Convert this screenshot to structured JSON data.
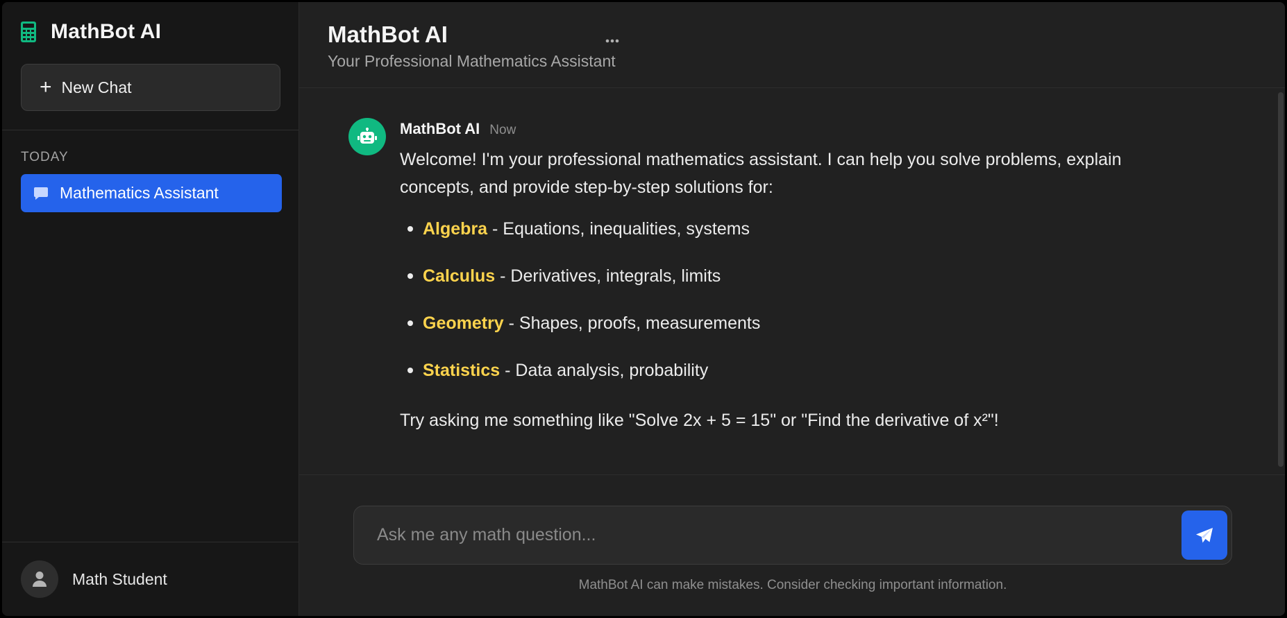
{
  "sidebar": {
    "brand_title": "MathBot AI",
    "new_chat_label": "New Chat",
    "section_label": "TODAY",
    "active_chat_label": "Mathematics Assistant",
    "user_name": "Math Student"
  },
  "header": {
    "title": "MathBot AI",
    "subtitle": "Your Professional Mathematics Assistant"
  },
  "message": {
    "author": "MathBot AI",
    "time": "Now",
    "intro": "Welcome! I'm your professional mathematics assistant. I can help you solve problems, explain concepts, and provide step-by-step solutions for:",
    "topics": [
      {
        "name": "Algebra",
        "desc": " - Equations, inequalities, systems"
      },
      {
        "name": "Calculus",
        "desc": " - Derivatives, integrals, limits"
      },
      {
        "name": "Geometry",
        "desc": " - Shapes, proofs, measurements"
      },
      {
        "name": "Statistics",
        "desc": " - Data analysis, probability"
      }
    ],
    "outro": "Try asking me something like \"Solve 2x + 5 = 15\" or \"Find the derivative of x²\"!"
  },
  "composer": {
    "placeholder": "Ask me any math question...",
    "disclaimer": "MathBot AI can make mistakes. Consider checking important information."
  },
  "icons": {
    "brand": "calculator-icon",
    "new_chat": "plus-icon",
    "chat_item": "message-icon",
    "user": "user-icon",
    "bot": "robot-icon",
    "more": "ellipsis-icon",
    "send": "paper-plane-icon"
  },
  "colors": {
    "accent": "#2563eb",
    "brand_green": "#10b981",
    "topic_highlight": "#fcd34d"
  }
}
